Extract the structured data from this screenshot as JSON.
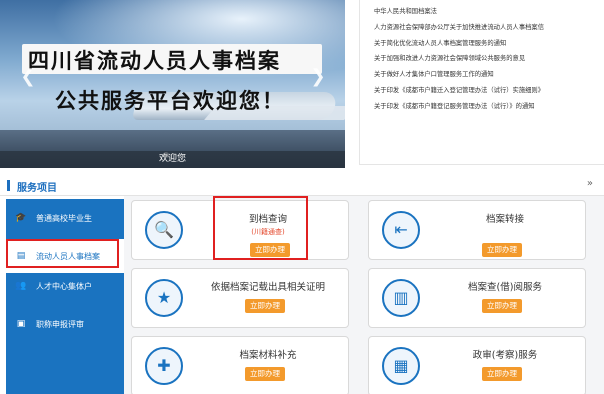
{
  "banner": {
    "line1": "四川省流动人员人事档案",
    "line2": "公共服务平台欢迎您！",
    "caption": "欢迎您",
    "prev_icon": "chevron-left-icon",
    "next_icon": "chevron-right-icon"
  },
  "news": [
    "中华人民共和国档案法",
    "人力资源社会保障部办公厅关于加快推进流动人员人事档案信",
    "关于简化优化流动人员人事档案管理服务的通知",
    "关于加强和改进人力资源社会保障领域公共服务的意见",
    "关于做好人才集体户口管理服务工作的通知",
    "关于印发《成都市户籍迁入登记管理办法（试行）实施细则》",
    "关于印发《成都市户籍登记服务管理办法（试行）》的通知"
  ],
  "section": {
    "title": "服务项目",
    "more": "»"
  },
  "nav": [
    {
      "label": "普通高校毕业生",
      "icon": "graduation-cap-icon"
    },
    {
      "label": "流动人员人事档案",
      "icon": "archive-box-icon"
    },
    {
      "label": "人才中心集体户",
      "icon": "users-icon"
    },
    {
      "label": "职称申报评审",
      "icon": "certificate-icon"
    }
  ],
  "cards": [
    {
      "title": "到档查询",
      "sub": "(川籍通查)",
      "button": "立即办理",
      "icon": "document-search-icon"
    },
    {
      "title": "档案转接",
      "sub": "",
      "button": "立即办理",
      "icon": "document-transfer-icon"
    },
    {
      "title": "依据档案记载出具相关证明",
      "sub": "",
      "button": "立即办理",
      "icon": "certified-document-icon"
    },
    {
      "title": "档案查(借)阅服务",
      "sub": "",
      "button": "立即办理",
      "icon": "binders-icon"
    },
    {
      "title": "档案材料补充",
      "sub": "",
      "button": "立即办理",
      "icon": "file-add-icon"
    },
    {
      "title": "政审(考察)服务",
      "sub": "",
      "button": "立即办理",
      "icon": "id-card-icon"
    }
  ],
  "colors": {
    "primary": "#1a73c0",
    "accent": "#f39a2c",
    "highlight": "#e02020",
    "sub_text": "#e4472b"
  }
}
